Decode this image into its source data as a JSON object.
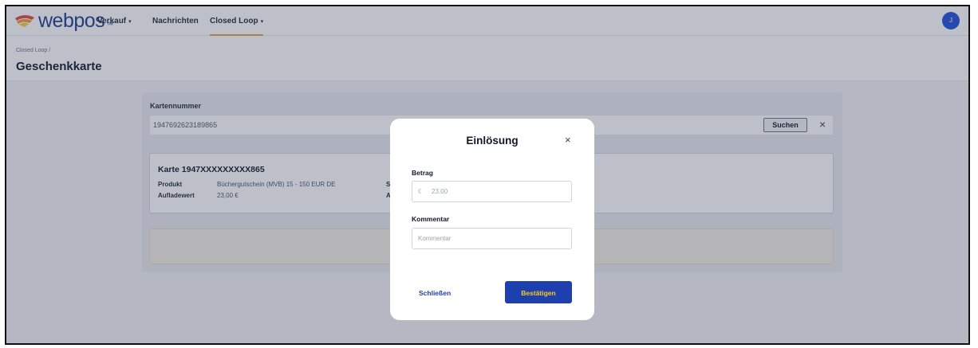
{
  "navbar": {
    "brand": "webpos",
    "brand_mark": "™",
    "items": [
      {
        "label": "Verkauf",
        "caret": "▾"
      },
      {
        "label": "Nachrichten",
        "caret": ""
      },
      {
        "label": "Closed Loop",
        "caret": "▾"
      }
    ],
    "avatar_initial": "J",
    "accent_color": "#d9a441",
    "brand_color": "#1c3d8c"
  },
  "header": {
    "breadcrumb": "Closed Loop /",
    "title": "Geschenkkarte"
  },
  "search": {
    "label": "Kartennummer",
    "value": "1947692623189865",
    "button_label": "Suchen",
    "clear_icon": "×"
  },
  "card": {
    "title": "Karte 1947XXXXXXXXX865",
    "product_label": "Produkt",
    "product_value": "Büchergutschein (MVB) 15 - 150 EUR DE",
    "value_label": "Aufladewert",
    "value_value": "23,00 €",
    "partial_label_1": "S",
    "partial_label_2": "A"
  },
  "modal": {
    "title": "Einlösung",
    "close_icon": "×",
    "amount_label": "Betrag",
    "amount_currency": "€",
    "amount_value": "23.00",
    "comment_label": "Kommentar",
    "comment_placeholder": "Kommentar",
    "close_button": "Schließen",
    "confirm_button": "Bestätigen",
    "confirm_color": "#1e40af",
    "confirm_text_color": "#facc15"
  }
}
